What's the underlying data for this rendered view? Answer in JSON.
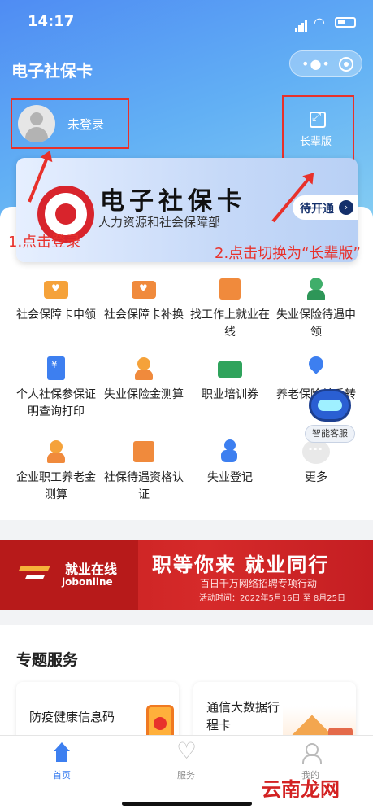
{
  "status": {
    "time": "14:17"
  },
  "header": {
    "app_title": "电子社保卡"
  },
  "login": {
    "text": "未登录"
  },
  "elder_mode": {
    "label": "长辈版"
  },
  "annotations": {
    "login_note": "1.点击登录",
    "elder_note": "2.点击切换为“长辈版”"
  },
  "card": {
    "title": "电子社保卡",
    "subtitle": "人力资源和社会保障部",
    "open_button": "待开通"
  },
  "services": [
    {
      "label": "社会保障卡申领",
      "icon": "card-heart-icon"
    },
    {
      "label": "社会保障卡补换",
      "icon": "card-replace-icon"
    },
    {
      "label": "找工作上就业在线",
      "icon": "job-search-icon"
    },
    {
      "label": "失业保险待遇申领",
      "icon": "benefit-apply-icon"
    },
    {
      "label": "个人社保参保证明查询打印",
      "icon": "certificate-icon"
    },
    {
      "label": "失业保险金测算",
      "icon": "calculator-person-icon"
    },
    {
      "label": "职业培训券",
      "icon": "training-ticket-icon"
    },
    {
      "label": "养老保险关系转移",
      "icon": "transfer-map-icon"
    },
    {
      "label": "企业职工养老金测算",
      "icon": "elderly-icon"
    },
    {
      "label": "社保待遇资格认证",
      "icon": "certification-icon"
    },
    {
      "label": "失业登记",
      "icon": "register-icon"
    },
    {
      "label": "更多",
      "icon": "more-icon"
    }
  ],
  "robot": {
    "label": "智能客服"
  },
  "job_banner": {
    "brand": "就业在线",
    "brand_en": "jobonline",
    "headline": "职等你来  就业同行",
    "subline": "— 百日千万网络招聘专项行动 —",
    "date": "活动时间：2022年5月16日 至 8月25日"
  },
  "topic": {
    "title": "专题服务",
    "cards": [
      {
        "label": "防疫健康信息码"
      },
      {
        "label": "通信大数据行程卡"
      }
    ]
  },
  "tabbar": {
    "tabs": [
      {
        "label": "首页",
        "active": true
      },
      {
        "label": "服务",
        "active": false
      },
      {
        "label": "我的",
        "active": false
      }
    ]
  },
  "watermark": "云南龙网",
  "colors": {
    "accent": "#3d7ff0",
    "annotation_red": "#e8312b",
    "banner_red": "#d62a2a"
  }
}
